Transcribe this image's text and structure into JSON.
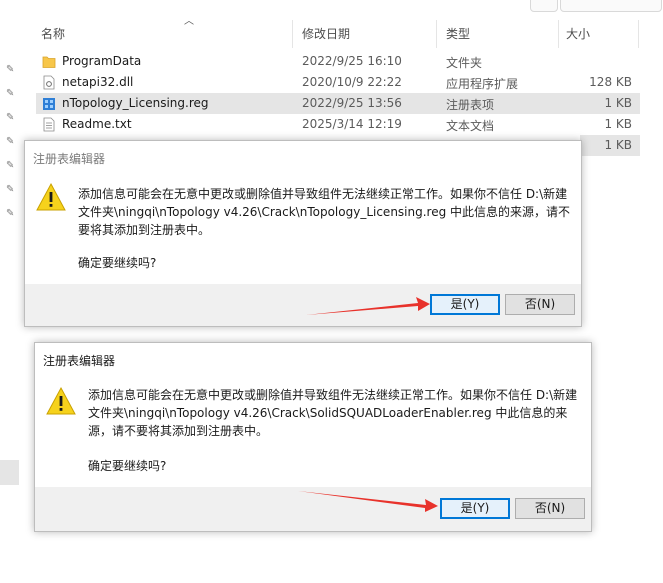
{
  "explorer": {
    "columns": {
      "name": "名称",
      "modified": "修改日期",
      "type": "类型",
      "size": "大小"
    },
    "files": [
      {
        "name": "ProgramData",
        "icon": "folder-icon",
        "modified": "2022/9/25 16:10",
        "type": "文件夹",
        "size": ""
      },
      {
        "name": "netapi32.dll",
        "icon": "dll-file-icon",
        "modified": "2020/10/9 22:22",
        "type": "应用程序扩展",
        "size": "128 KB"
      },
      {
        "name": "nTopology_Licensing.reg",
        "icon": "registry-file-icon",
        "modified": "2022/9/25 13:56",
        "type": "注册表项",
        "size": "1 KB"
      },
      {
        "name": "Readme.txt",
        "icon": "text-file-icon",
        "modified": "2025/3/14 12:19",
        "type": "文本文档",
        "size": "1 KB"
      }
    ],
    "hidden_row_size": "1 KB"
  },
  "dialogs": [
    {
      "title": "注册表编辑器",
      "message_lines": [
        "添加信息可能会在无意中更改或删除值并导致组件无法继续正常工作。如果你不信任 D:\\新建",
        "文件夹\\ningqi\\nTopology v4.26\\Crack\\nTopology_Licensing.reg 中此信息的来源，请不",
        "要将其添加到注册表中。"
      ],
      "confirm": "确定要继续吗?",
      "yes_label": "是(Y)",
      "no_label": "否(N)"
    },
    {
      "title": "注册表编辑器",
      "message_lines": [
        "添加信息可能会在无意中更改或删除值并导致组件无法继续正常工作。如果你不信任 D:\\新建",
        "文件夹\\ningqi\\nTopology v4.26\\Crack\\SolidSQUADLoaderEnabler.reg 中此信息的来",
        "源，请不要将其添加到注册表中。"
      ],
      "confirm": "确定要继续吗?",
      "yes_label": "是(Y)",
      "no_label": "否(N)"
    }
  ],
  "colors": {
    "accent": "#0078d7",
    "arrow": "#e8322b",
    "warning": "#f6d21c",
    "folder": "#f7c64a"
  }
}
